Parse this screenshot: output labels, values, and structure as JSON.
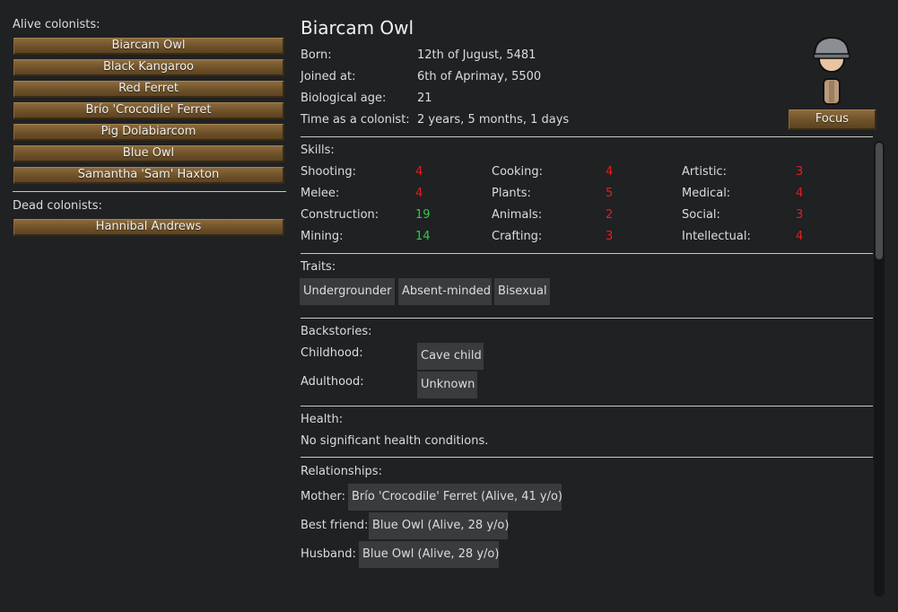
{
  "sidebar": {
    "alive_label": "Alive colonists:",
    "alive": [
      {
        "name": "Biarcam Owl"
      },
      {
        "name": "Black Kangaroo"
      },
      {
        "name": "Red Ferret"
      },
      {
        "name": "Brío 'Crocodile' Ferret"
      },
      {
        "name": "Pig Dolabiarcom"
      },
      {
        "name": "Blue Owl"
      },
      {
        "name": "Samantha 'Sam' Haxton"
      }
    ],
    "dead_label": "Dead colonists:",
    "dead": [
      {
        "name": "Hannibal Andrews"
      }
    ]
  },
  "colonist": {
    "name": "Biarcam Owl",
    "focus_label": "Focus",
    "info": [
      {
        "label": "Born:",
        "value": "12th of Jugust, 5481"
      },
      {
        "label": "Joined at:",
        "value": "6th of Aprimay, 5500"
      },
      {
        "label": "Biological age:",
        "value": "21"
      },
      {
        "label": "Time as a colonist:",
        "value": "2 years, 5 months, 1 days"
      }
    ]
  },
  "skills": {
    "label": "Skills:",
    "items": [
      {
        "name": "Shooting:",
        "value": "4",
        "color": "#e02020"
      },
      {
        "name": "Cooking:",
        "value": "4",
        "color": "#e02020"
      },
      {
        "name": "Artistic:",
        "value": "3",
        "color": "#e02020"
      },
      {
        "name": "Melee:",
        "value": "4",
        "color": "#e02020"
      },
      {
        "name": "Plants:",
        "value": "5",
        "color": "#e02020"
      },
      {
        "name": "Medical:",
        "value": "4",
        "color": "#e02020"
      },
      {
        "name": "Construction:",
        "value": "19",
        "color": "#2ecc40"
      },
      {
        "name": "Animals:",
        "value": "2",
        "color": "#e02020"
      },
      {
        "name": "Social:",
        "value": "3",
        "color": "#e02020"
      },
      {
        "name": "Mining:",
        "value": "14",
        "color": "#2ecc40"
      },
      {
        "name": "Crafting:",
        "value": "3",
        "color": "#e02020"
      },
      {
        "name": "Intellectual:",
        "value": "4",
        "color": "#e02020"
      }
    ]
  },
  "traits": {
    "label": "Traits:",
    "items": [
      "Undergrounder",
      "Absent-minded",
      "Bisexual"
    ]
  },
  "backstories": {
    "label": "Backstories:",
    "childhood_label": "Childhood:",
    "childhood": "Cave child",
    "adulthood_label": "Adulthood:",
    "adulthood": "Unknown"
  },
  "health": {
    "label": "Health:",
    "text": "No significant health conditions."
  },
  "relationships": {
    "label": "Relationships:",
    "items": [
      {
        "relation": "Mother:",
        "person": "Brío 'Crocodile' Ferret (Alive, 41 y/o)"
      },
      {
        "relation": "Best friend:",
        "person": "Blue Owl (Alive, 28 y/o)"
      },
      {
        "relation": "Husband:",
        "person": "Blue Owl (Alive, 28 y/o)"
      }
    ]
  },
  "icons": {
    "portrait": "colonist-portrait-icon"
  }
}
